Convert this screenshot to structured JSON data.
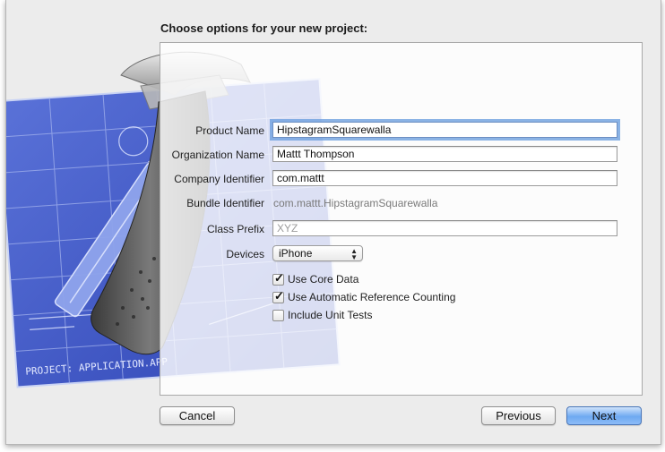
{
  "dialog": {
    "title": "Choose options for your new project:"
  },
  "artwork": {
    "blueprint_caption": "PROJECT: APPLICATION.APP"
  },
  "form": {
    "product_name": {
      "label": "Product Name",
      "value": "HipstagramSquarewalla"
    },
    "organization_name": {
      "label": "Organization Name",
      "value": "Mattt Thompson"
    },
    "company_identifier": {
      "label": "Company Identifier",
      "value": "com.mattt"
    },
    "bundle_identifier": {
      "label": "Bundle Identifier",
      "value": "com.mattt.HipstagramSquarewalla"
    },
    "class_prefix": {
      "label": "Class Prefix",
      "value": "",
      "placeholder": "XYZ"
    },
    "devices": {
      "label": "Devices",
      "selected": "iPhone"
    },
    "options": [
      {
        "label": "Use Core Data",
        "checked": true
      },
      {
        "label": "Use Automatic Reference Counting",
        "checked": true
      },
      {
        "label": "Include Unit Tests",
        "checked": false
      }
    ]
  },
  "buttons": {
    "cancel": "Cancel",
    "previous": "Previous",
    "next": "Next"
  },
  "colors": {
    "blueprint": "#3d56c7",
    "primary_button": "#6ea9f1",
    "focus_ring": "#659bde"
  }
}
